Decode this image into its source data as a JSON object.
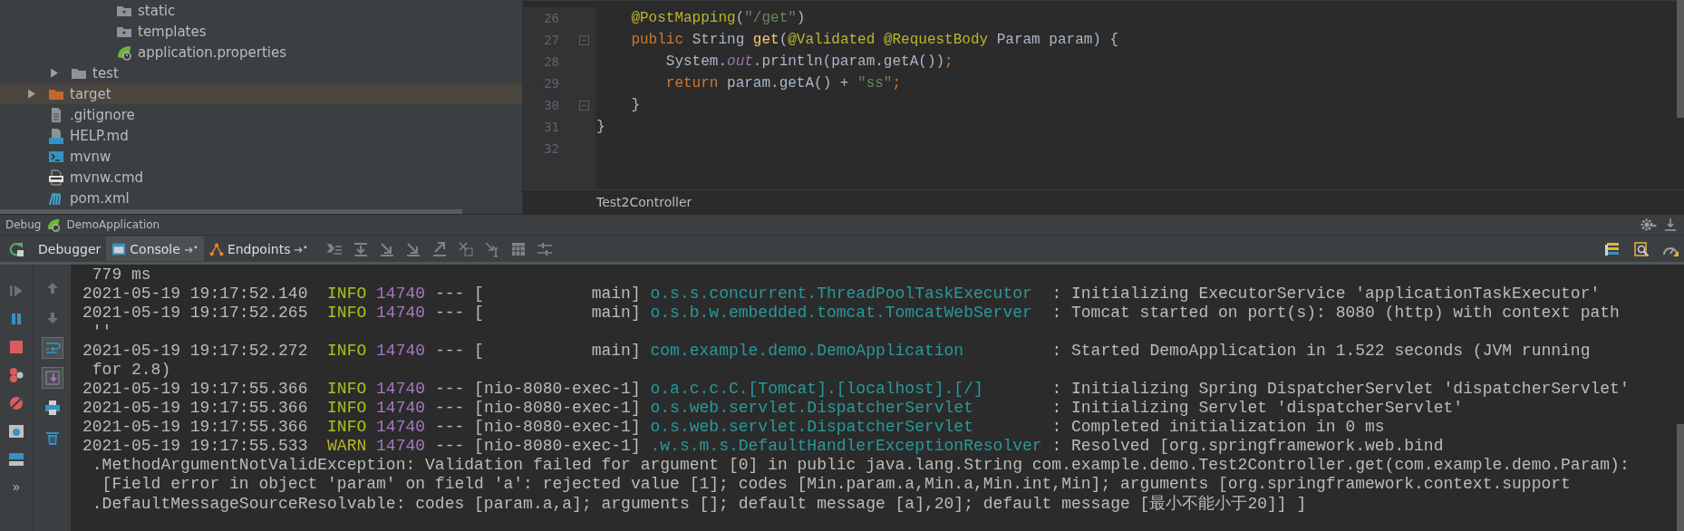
{
  "project": {
    "tree": [
      {
        "children": [
          {
            "children": [
              {
                "children": [
                  {
                    "children": [
                      {
                        "name": "static",
                        "kind": "resource-folder",
                        "selected": false
                      },
                      {
                        "name": "templates",
                        "kind": "resource-folder",
                        "selected": false
                      },
                      {
                        "name": "application.properties",
                        "kind": "spring-config",
                        "selected": false
                      }
                    ]
                  }
                ]
              },
              {
                "name": "test",
                "kind": "folder",
                "expanded": false,
                "selected": false
              }
            ]
          },
          {
            "name": "target",
            "kind": "excluded-folder",
            "expanded": false,
            "selected": true
          },
          {
            "name": ".gitignore",
            "kind": "text-file",
            "selected": false
          },
          {
            "name": "HELP.md",
            "kind": "markdown-file",
            "selected": false
          },
          {
            "name": "mvnw",
            "kind": "shell-script",
            "selected": false
          },
          {
            "name": "mvnw.cmd",
            "kind": "cmd-file",
            "selected": false
          },
          {
            "name": "pom.xml",
            "kind": "maven-file",
            "selected": false
          }
        ]
      }
    ]
  },
  "editor": {
    "lines": [
      {
        "number": "26",
        "fold": false,
        "tokens": [
          {
            "text": "    @PostMapping",
            "kind": "annotation"
          },
          {
            "text": "(",
            "kind": "plain"
          },
          {
            "text": "\"/get\"",
            "kind": "string"
          },
          {
            "text": ")",
            "kind": "plain"
          }
        ]
      },
      {
        "number": "27",
        "fold": true,
        "tokens": [
          {
            "text": "    public ",
            "kind": "keyword"
          },
          {
            "text": "String ",
            "kind": "plain"
          },
          {
            "text": "get",
            "kind": "method"
          },
          {
            "text": "(",
            "kind": "plain"
          },
          {
            "text": "@Validated ",
            "kind": "annotation"
          },
          {
            "text": "@RequestBody",
            "kind": "annotation"
          },
          {
            "text": " Param param) {",
            "kind": "plain"
          }
        ]
      },
      {
        "number": "28",
        "fold": false,
        "tokens": [
          {
            "text": "        System.",
            "kind": "plain"
          },
          {
            "text": "out",
            "kind": "field"
          },
          {
            "text": ".println(param.getA())",
            "kind": "plain"
          },
          {
            "text": ";",
            "kind": "keyword"
          }
        ]
      },
      {
        "number": "29",
        "fold": false,
        "tokens": [
          {
            "text": "        return ",
            "kind": "keyword"
          },
          {
            "text": "param.getA() + ",
            "kind": "plain"
          },
          {
            "text": "\"ss\"",
            "kind": "string"
          },
          {
            "text": ";",
            "kind": "keyword"
          }
        ]
      },
      {
        "number": "30",
        "fold": true,
        "tokens": [
          {
            "text": "    }",
            "kind": "plain"
          }
        ]
      },
      {
        "number": "31",
        "fold": false,
        "tokens": [
          {
            "text": "}",
            "kind": "plain"
          }
        ]
      },
      {
        "number": "32",
        "fold": false
      }
    ],
    "breadcrumb": "Test2Controller"
  },
  "debug": {
    "title": "Debug",
    "run_tab": "DemoApplication",
    "tabs": [
      {
        "label": "Debugger",
        "kind": "plain",
        "selected": false
      },
      {
        "label": "Console",
        "kind": "console",
        "selected": true
      },
      {
        "label": "Endpoints",
        "kind": "endpoints",
        "selected": false
      }
    ],
    "side_tools": [
      {
        "kind": "up",
        "on": false
      },
      {
        "kind": "down",
        "on": false
      },
      {
        "kind": "soft-wrap",
        "on": true
      },
      {
        "kind": "scroll-end",
        "on": true
      },
      {
        "kind": "print",
        "on": false
      },
      {
        "kind": "trash",
        "on": false
      }
    ],
    "more": "»",
    "console": [
      {
        "kind": "text",
        "text": " 779 ms"
      },
      {
        "kind": "log",
        "time": "2021-05-19 19:17:52.140",
        "level": "INFO",
        "warning": false,
        "pid": "14740",
        "sep": "---",
        "thread": "[           main]",
        "logger": "o.s.s.concurrent.ThreadPoolTaskExecutor",
        "message": ": Initializing ExecutorService 'applicationTaskExecutor'"
      },
      {
        "kind": "log",
        "time": "2021-05-19 19:17:52.265",
        "level": "INFO",
        "warning": false,
        "pid": "14740",
        "sep": "---",
        "thread": "[           main]",
        "logger": "o.s.b.w.embedded.tomcat.TomcatWebServer",
        "message": ": Tomcat started on port(s): 8080 (http) with context path"
      },
      {
        "kind": "text",
        "text": " ''"
      },
      {
        "kind": "log",
        "time": "2021-05-19 19:17:52.272",
        "level": "INFO",
        "warning": false,
        "pid": "14740",
        "sep": "---",
        "thread": "[           main]",
        "logger": "com.example.demo.DemoApplication",
        "message": ": Started DemoApplication in 1.522 seconds (JVM running"
      },
      {
        "kind": "text",
        "text": " for 2.8)"
      },
      {
        "kind": "log",
        "time": "2021-05-19 19:17:55.366",
        "level": "INFO",
        "warning": false,
        "pid": "14740",
        "sep": "---",
        "thread": "[nio-8080-exec-1]",
        "logger": "o.a.c.c.C.[Tomcat].[localhost].[/]",
        "message": ": Initializing Spring DispatcherServlet 'dispatcherServlet'"
      },
      {
        "kind": "log",
        "time": "2021-05-19 19:17:55.366",
        "level": "INFO",
        "warning": false,
        "pid": "14740",
        "sep": "---",
        "thread": "[nio-8080-exec-1]",
        "logger": "o.s.web.servlet.DispatcherServlet",
        "message": ": Initializing Servlet 'dispatcherServlet'"
      },
      {
        "kind": "log",
        "time": "2021-05-19 19:17:55.366",
        "level": "INFO",
        "warning": false,
        "pid": "14740",
        "sep": "---",
        "thread": "[nio-8080-exec-1]",
        "logger": "o.s.web.servlet.DispatcherServlet",
        "message": ": Completed initialization in 0 ms"
      },
      {
        "kind": "log",
        "time": "2021-05-19 19:17:55.533",
        "level": "WARN",
        "warning": true,
        "pid": "14740",
        "sep": "---",
        "thread": "[nio-8080-exec-1]",
        "logger": ".w.s.m.s.DefaultHandlerExceptionResolver",
        "message": ": Resolved [org.springframework.web.bind"
      },
      {
        "kind": "text",
        "text": " .MethodArgumentNotValidException: Validation failed for argument [0] in public java.lang.String com.example.demo.Test2Controller.get(com.example.demo.Param):"
      },
      {
        "kind": "text",
        "text": "  [Field error in object 'param' on field 'a': rejected value [1]; codes [Min.param.a,Min.a,Min.int,Min]; arguments [org.springframework.context.support"
      },
      {
        "kind": "text",
        "text": " .DefaultMessageSourceResolvable: codes [param.a,a]; arguments []; default message [a],20]; default message [最小不能小于20]] ]"
      }
    ]
  }
}
